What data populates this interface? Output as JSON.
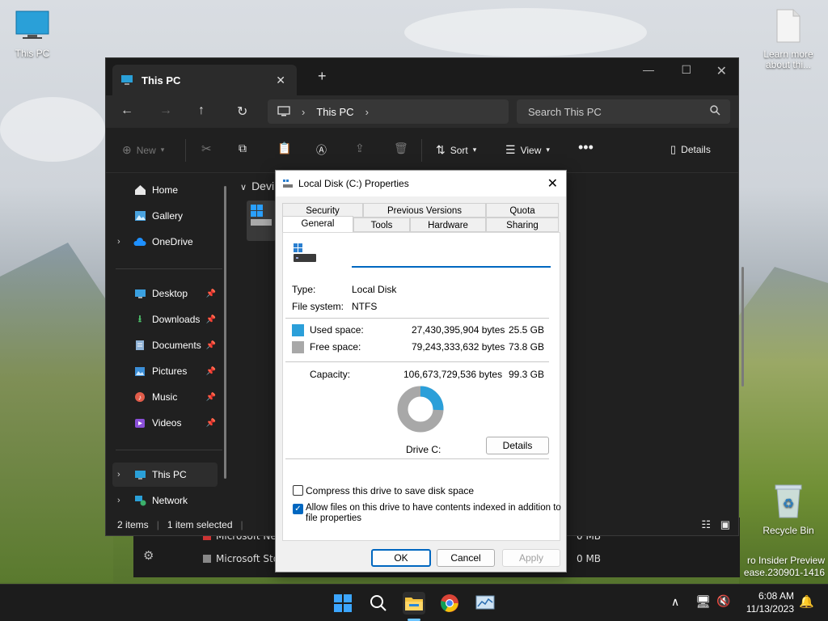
{
  "desktop": {
    "icons": [
      {
        "label": "This PC",
        "icon": "monitor-icon"
      },
      {
        "label": "Learn more about thi...",
        "icon": "document-icon"
      },
      {
        "label": "Recycle Bin",
        "icon": "recycle-bin-icon"
      }
    ],
    "watermark_line1": "ro Insider Preview",
    "watermark_line2": "ease.230901-1416"
  },
  "explorer": {
    "tab_title": "This PC",
    "address_crumb": "This PC",
    "search_placeholder": "Search This PC",
    "toolbar": {
      "new_label": "New",
      "sort_label": "Sort",
      "view_label": "View",
      "details_label": "Details"
    },
    "sidebar": {
      "items": [
        {
          "label": "Home",
          "icon": "home-icon"
        },
        {
          "label": "Gallery",
          "icon": "gallery-icon"
        },
        {
          "label": "OneDrive",
          "icon": "cloud-icon"
        },
        {
          "label": "Desktop",
          "icon": "desktop-folder-icon"
        },
        {
          "label": "Downloads",
          "icon": "download-icon"
        },
        {
          "label": "Documents",
          "icon": "documents-icon"
        },
        {
          "label": "Pictures",
          "icon": "pictures-icon"
        },
        {
          "label": "Music",
          "icon": "music-icon"
        },
        {
          "label": "Videos",
          "icon": "videos-icon"
        },
        {
          "label": "This PC",
          "icon": "monitor-icon"
        },
        {
          "label": "Network",
          "icon": "network-icon"
        }
      ]
    },
    "content_heading": "Devi",
    "status_items": "2 items",
    "status_selected": "1 item selected",
    "bg_rows": [
      {
        "name": "Microsoft Ne",
        "size": "0 MB"
      },
      {
        "name": "Microsoft Sto",
        "size": "0 MB"
      }
    ]
  },
  "dialog": {
    "title": "Local Disk (C:) Properties",
    "tabs_row1": [
      "Security",
      "Previous Versions",
      "Quota"
    ],
    "tabs_row2": [
      "General",
      "Tools",
      "Hardware",
      "Sharing"
    ],
    "active_tab": "General",
    "name_value": "",
    "type_label": "Type:",
    "type_value": "Local Disk",
    "fs_label": "File system:",
    "fs_value": "NTFS",
    "used_label": "Used space:",
    "used_bytes": "27,430,395,904 bytes",
    "used_gb": "25.5 GB",
    "free_label": "Free space:",
    "free_bytes": "79,243,333,632 bytes",
    "free_gb": "73.8 GB",
    "capacity_label": "Capacity:",
    "capacity_bytes": "106,673,729,536 bytes",
    "capacity_gb": "99.3 GB",
    "drive_label": "Drive C:",
    "details_button": "Details",
    "compress_label": "Compress this drive to save disk space",
    "compress_checked": false,
    "index_label_line1": "Allow files on this drive to have contents indexed in addition to",
    "index_label_line2": "file properties",
    "index_checked": true,
    "ok_label": "OK",
    "cancel_label": "Cancel",
    "apply_label": "Apply",
    "used_color": "#2b9fd9",
    "free_color": "#a8a8a8",
    "used_fraction": 0.257
  },
  "taskbar": {
    "time": "6:08 AM",
    "date": "11/13/2023"
  }
}
